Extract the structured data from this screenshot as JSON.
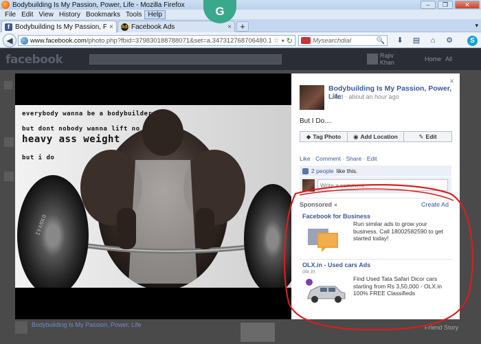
{
  "window": {
    "title": "Bodybuilding Is My Passion, Power, Life - Mozilla Firefox",
    "badge_letter": "G",
    "buttons": [
      "–",
      "❐",
      "✕"
    ]
  },
  "menu": [
    "File",
    "Edit",
    "View",
    "History",
    "Bookmarks",
    "Tools",
    "Help"
  ],
  "tabs": [
    {
      "label": "Bodybuilding Is My Passion, Power, L...",
      "favicon": "f",
      "active": true
    },
    {
      "label": "Facebook Ads",
      "favicon": "Ads",
      "active": false
    }
  ],
  "tab_close": "×",
  "new_tab": "+",
  "tab_menu": "▾",
  "nav": {
    "url_domain": "www.facebook.com",
    "url_path": "/photo.php?fbid=379830188788071&set=a.347312768706480.1073741828.34",
    "search_placeholder": "Mysearchdial",
    "back": "◀",
    "star": "☆",
    "drop": "▾",
    "reload": "↻",
    "mag": "🔍"
  },
  "fb_header": {
    "logo": "facebook",
    "profile_name": "Rajiv Khan",
    "home_label": "Home",
    "find_label": "All"
  },
  "photo": {
    "lines": [
      "everybody wanna be a bodybuilder",
      "but dont nobody wanna lift no",
      "heavy ass weight",
      "but i do"
    ],
    "plate_text": "IVANKO"
  },
  "panel": {
    "close": "×",
    "page_name": "Bodybuilding Is My Passion, Power, Life",
    "meta": "Liked · about an hour ago",
    "caption": "But I Do....",
    "actions": [
      {
        "label": "Tag Photo",
        "icon": "tag-icon"
      },
      {
        "label": "Add Location",
        "icon": "pin-icon"
      },
      {
        "label": "Edit",
        "icon": "pencil-icon"
      }
    ],
    "links": [
      "Like",
      "Comment",
      "Share",
      "Edit"
    ],
    "likes_count": "2 people",
    "likes_suffix": "like this.",
    "comment_placeholder": "Write a comment...",
    "sponsored": "Sponsored",
    "create_ad": "Create Ad"
  },
  "ads": [
    {
      "title": "Facebook for Business",
      "subtitle": "",
      "text": "Run similar ads to grow your business. Call 18002582590 to get started today!"
    },
    {
      "title": "OLX.in - Used cars Ads",
      "subtitle": "olx.in",
      "text": "Find Used Tata Safari Dicor cars starting from Rs 3,50,000 - OLX.in 100% FREE Classifieds"
    }
  ],
  "background": {
    "post_title": "Bodybuilding Is My Passion, Power, Life",
    "right_label": "Friend Story"
  },
  "colors": {
    "fb_blue": "#3b5998",
    "annotation_red": "#d81e1e"
  }
}
